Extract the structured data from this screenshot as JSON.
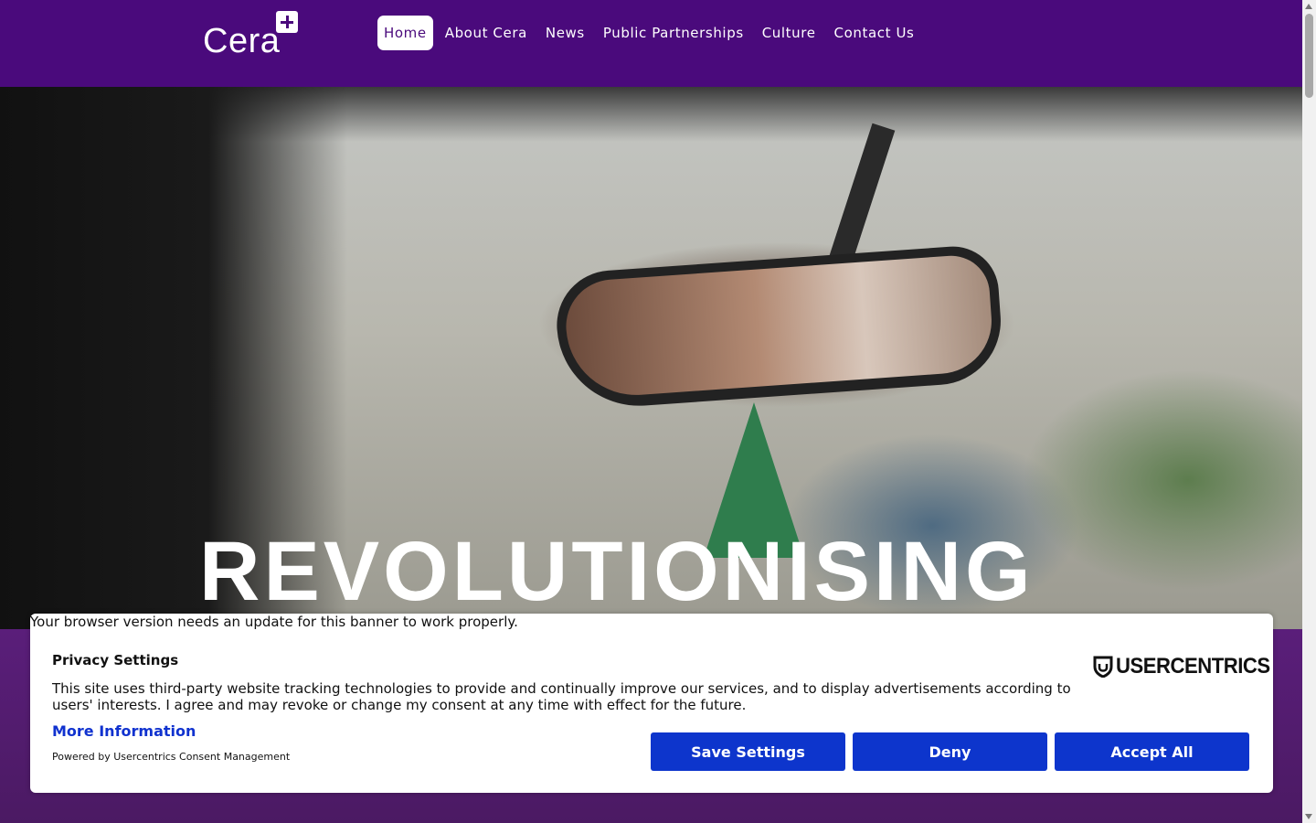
{
  "header": {
    "logo_text": "Cera",
    "nav": [
      {
        "label": "Home",
        "active": true
      },
      {
        "label": "About Cera",
        "active": false
      },
      {
        "label": "News",
        "active": false
      },
      {
        "label": "Public Partnerships",
        "active": false
      },
      {
        "label": "Culture",
        "active": false
      },
      {
        "label": "Contact Us",
        "active": false
      }
    ]
  },
  "hero": {
    "title": "REVOLUTIONISING"
  },
  "consent": {
    "browser_note": "Your browser version needs an update for this banner to work properly.",
    "title": "Privacy Settings",
    "text": "This site uses third-party website tracking technologies to provide and continually improve our services, and to display advertisements according to users' interests. I agree and may revoke or change my consent at any time with effect for the future.",
    "more_info": "More Information",
    "powered_by": "Powered by Usercentrics Consent Management",
    "brand": "USERCENTRICS",
    "buttons": {
      "save": "Save Settings",
      "deny": "Deny",
      "accept": "Accept All"
    }
  },
  "colors": {
    "header_bg": "#4a0a7c",
    "button_bg": "#0d35cc",
    "link": "#1032cf"
  }
}
